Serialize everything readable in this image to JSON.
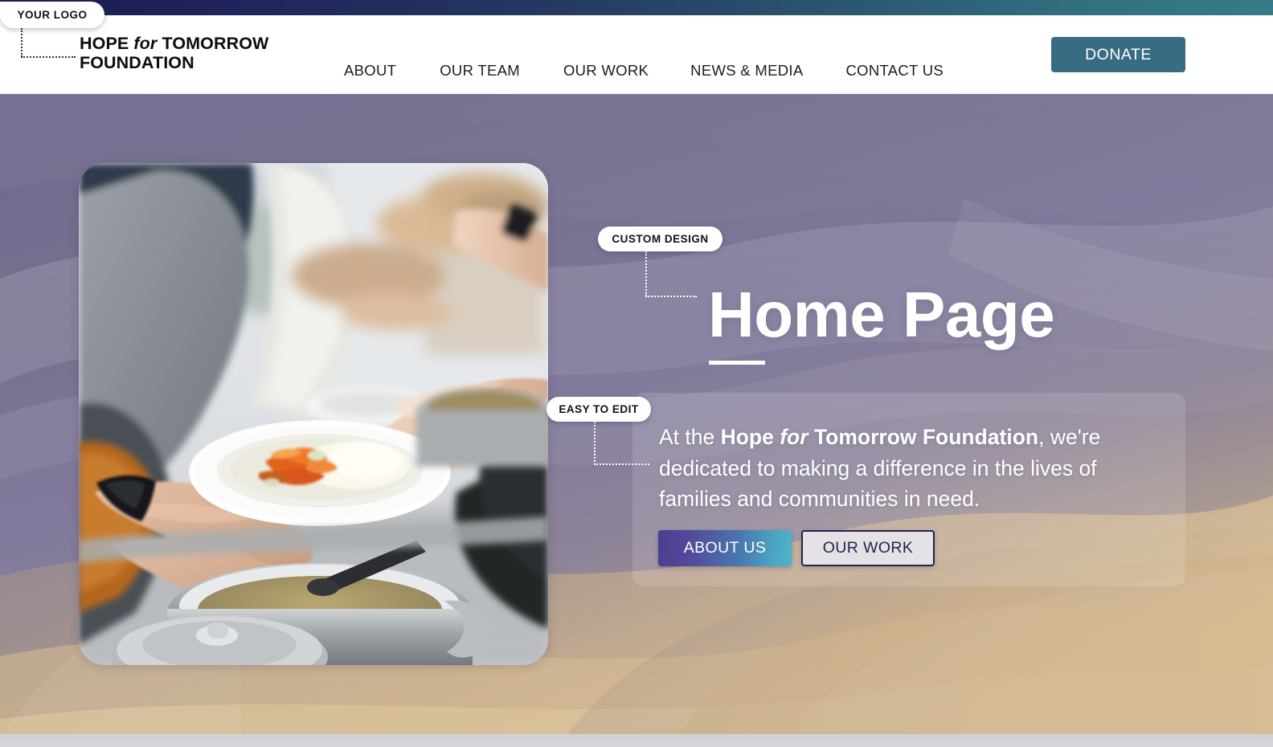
{
  "topbar": {
    "gradient_start": "#1b1d4e",
    "gradient_end": "#357b86"
  },
  "callouts": {
    "logo_badge": "YOUR LOGO",
    "custom_design_badge": "CUSTOM DESIGN",
    "easy_to_edit_badge": "EASY TO EDIT"
  },
  "header": {
    "brand": {
      "line1_a": "HOPE",
      "line1_italic": "for",
      "line1_b": "TOMORROW",
      "line2": "FOUNDATION"
    },
    "nav": [
      {
        "label": "ABOUT"
      },
      {
        "label": "OUR TEAM"
      },
      {
        "label": "OUR WORK"
      },
      {
        "label": "NEWS & MEDIA"
      },
      {
        "label": "CONTACT US"
      }
    ],
    "donate_label": "DONATE",
    "donate_color": "#386c83"
  },
  "hero": {
    "headline": "Home Page",
    "body": {
      "part1": "At the ",
      "bold1": "Hope",
      "italic": " for ",
      "bold2": "Tomorrow Foundation",
      "part2": ", we're dedicated to making a difference in the lives of families and communities in need."
    },
    "cta": {
      "primary_label": "ABOUT US",
      "secondary_label": "OUR WORK",
      "primary_gradient_start": "#4b3e8e",
      "primary_gradient_end": "#4fb3c9"
    },
    "photo_alt": "hands-passing-plate-of-food-at-soup-kitchen",
    "background_top_color": "#6e698e",
    "background_bottom_color": "#ddc49c"
  }
}
